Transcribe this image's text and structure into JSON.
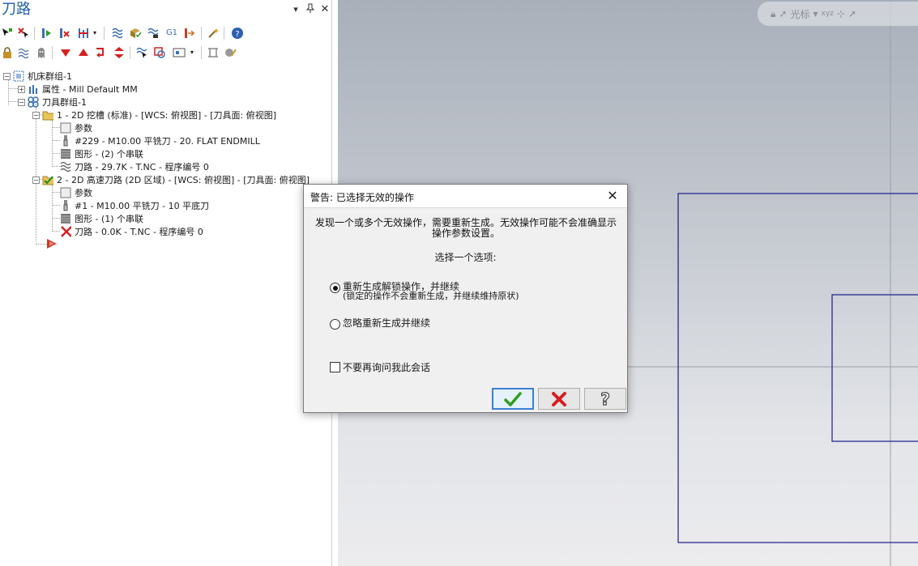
{
  "panel": {
    "title": "刀路",
    "controls": {
      "dropdown": "▾",
      "pin": "ᛘ",
      "close": "✕"
    }
  },
  "tree": {
    "machine_group": "机床群组-1",
    "properties": "属性 - Mill Default MM",
    "toolpath_group": "刀具群组-1",
    "op1": {
      "title": "1 - 2D 挖槽 (标准) - [WCS: 俯视图] - [刀具面: 俯视图]",
      "params": "参数",
      "tool": "#229 - M10.00 平铣刀 -    20. FLAT ENDMILL",
      "geometry": "图形 - (2) 个串联",
      "toolpath": "刀路 - 29.7K - T.NC - 程序编号 0"
    },
    "op2": {
      "title": "2 - 2D 高速刀路 (2D 区域) - [WCS: 俯视图] - [刀具面: 俯视图]",
      "params": "参数",
      "tool": "#1 - M10.00 平铣刀 - 10 平底刀",
      "geometry": "图形 - (1) 个串联",
      "toolpath": "刀路 - 0.0K - T.NC - 程序编号 0"
    }
  },
  "viewport": {
    "toolbar_label": "光标"
  },
  "dialog": {
    "title": "警告: 已选择无效的操作",
    "message_line1": "发现一个或多个无效操作，需要重新生成。无效操作可能不会准确显示",
    "message_line2": "操作参数设置。",
    "prompt": "选择一个选项:",
    "option1_label": "重新生成解锁操作，并继续",
    "option1_sub": "(锁定的操作不会重新生成，并继续维持原状)",
    "option1_selected": true,
    "option2_label": "忽略重新生成并继续",
    "option2_selected": false,
    "checkbox_label": "不要再询问我此会话",
    "checkbox_checked": false
  },
  "colors": {
    "accent": "#1f5fa8",
    "geometry_lines": "#1a1a8c",
    "ok_check": "#2e9e1e",
    "cancel_x": "#d42020"
  }
}
